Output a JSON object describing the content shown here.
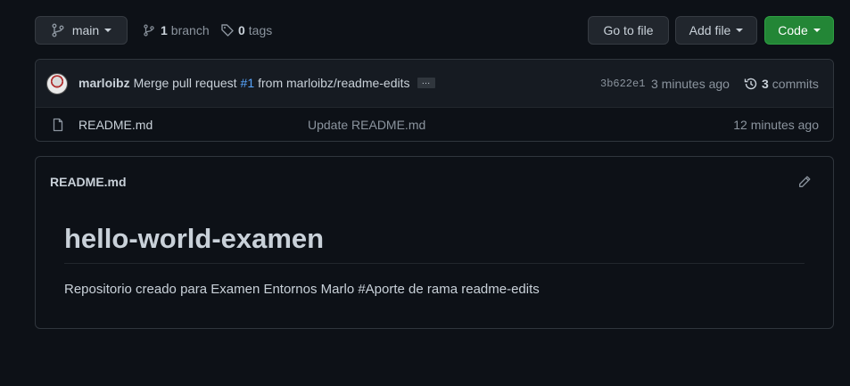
{
  "branch_select": {
    "label": "main",
    "icon": "git-branch-icon"
  },
  "branch_count": {
    "count": "1",
    "label": "branch"
  },
  "tag_count": {
    "count": "0",
    "label": "tags"
  },
  "actions": {
    "go_to_file": "Go to file",
    "add_file": "Add file",
    "code": "Code"
  },
  "latest_commit": {
    "author": "marloibz",
    "message_prefix": "Merge pull request",
    "pr_link": "#1",
    "message_suffix": "from marloibz/readme-edits",
    "ellipsis": "…",
    "sha": "3b622e1",
    "time": "3 minutes ago",
    "commits_count": "3",
    "commits_label": "commits"
  },
  "files": [
    {
      "name": "README.md",
      "commit_message": "Update README.md",
      "age": "12 minutes ago",
      "icon": "file-icon"
    }
  ],
  "readme": {
    "filename": "README.md",
    "heading": "hello-world-examen",
    "body": "Repositorio creado para Examen Entornos Marlo #Aporte de rama readme-edits",
    "edit_icon": "pencil-icon"
  },
  "colors": {
    "background": "#0d1117",
    "accent_green": "#238636",
    "link_blue": "#58a6ff",
    "border": "#30363d"
  }
}
